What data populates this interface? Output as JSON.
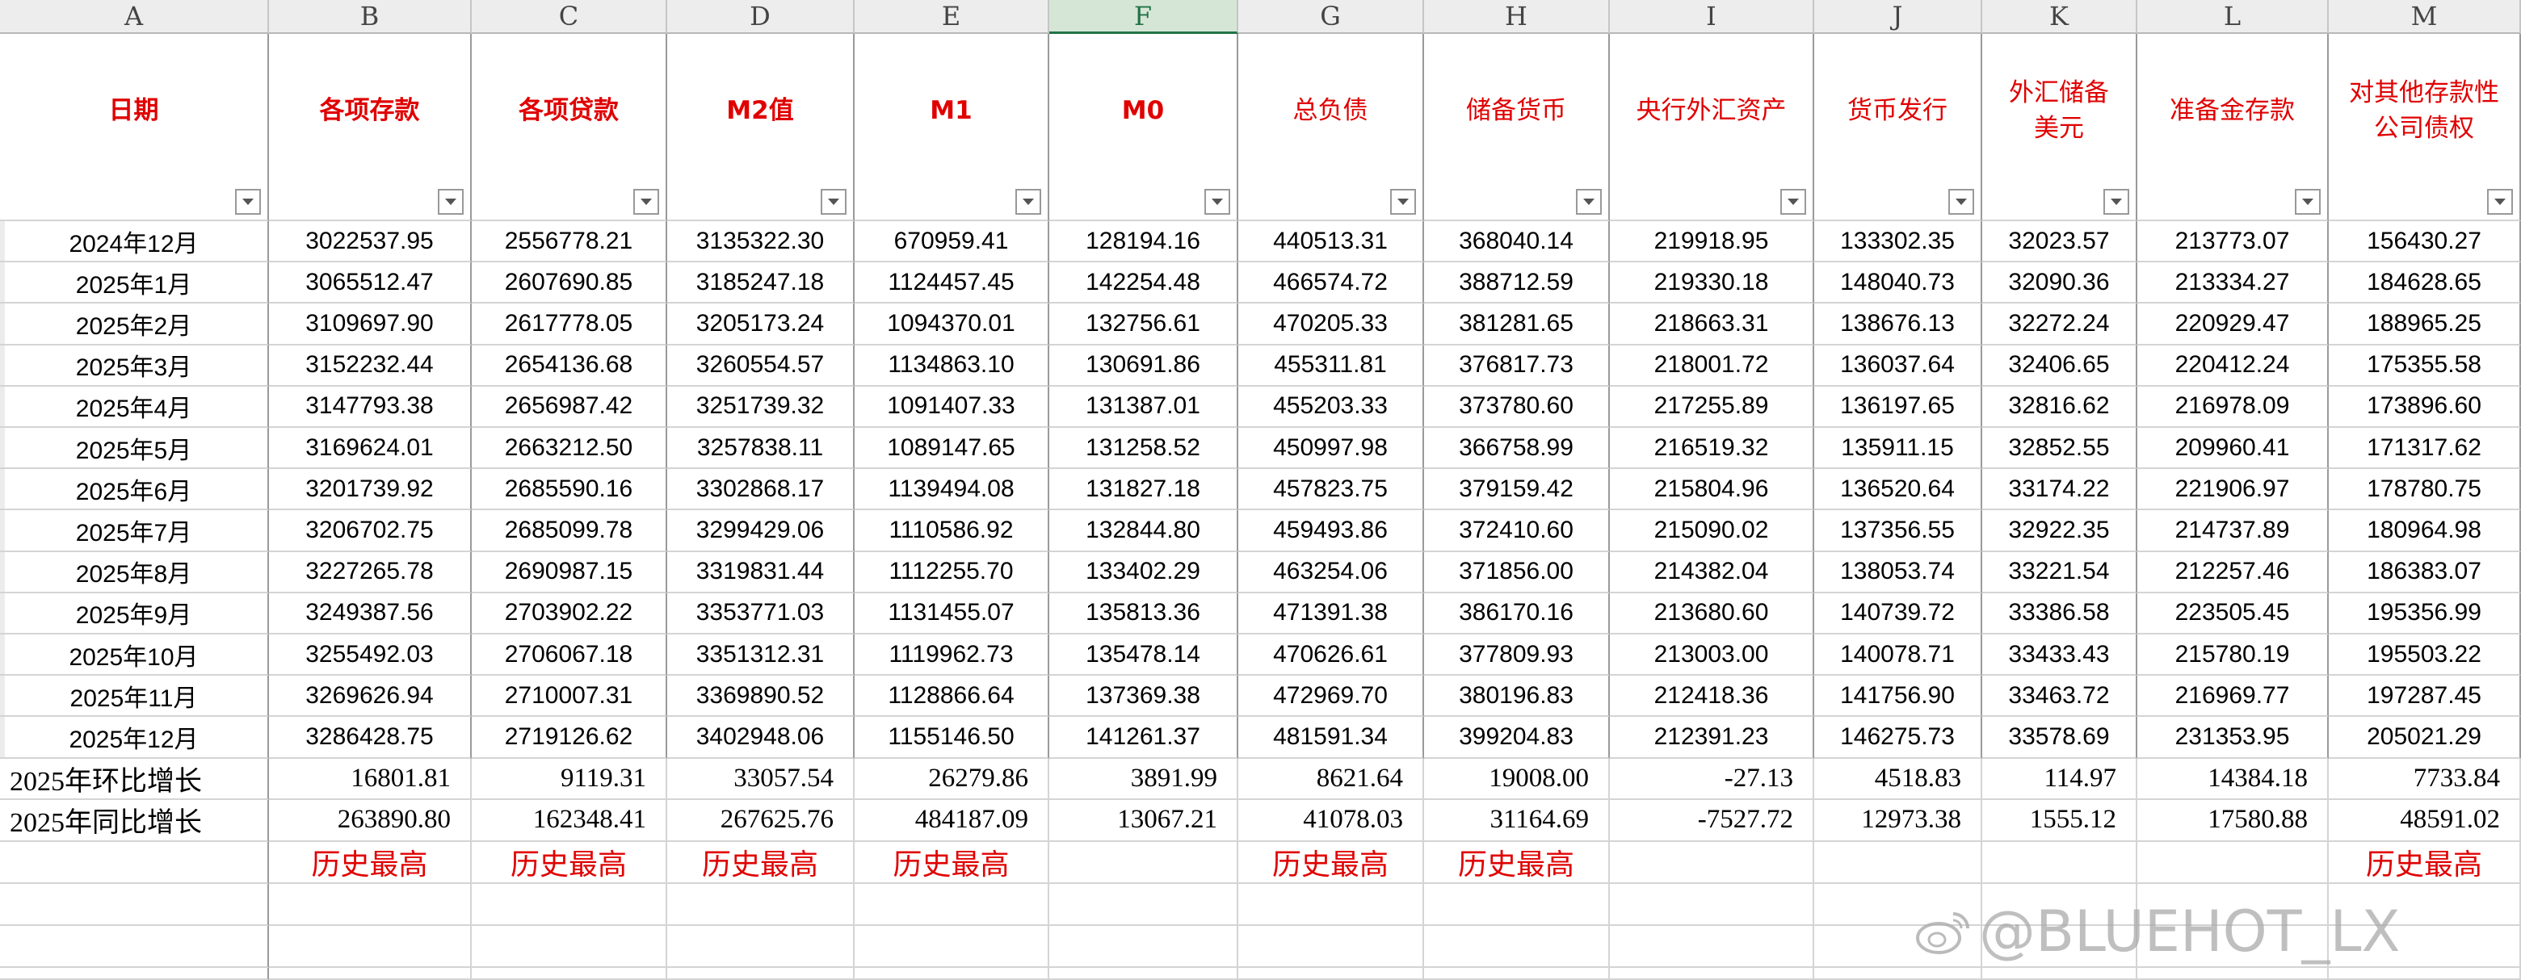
{
  "columns": [
    "A",
    "B",
    "C",
    "D",
    "E",
    "F",
    "G",
    "H",
    "I",
    "J",
    "K",
    "L",
    "M"
  ],
  "selected_column": "F",
  "headers": [
    "日期",
    "各项存款",
    "各项贷款",
    "M2值",
    "M1",
    "M0",
    "总负债",
    "储备货币",
    "央行外汇资产",
    "货币发行",
    "外汇储备美元",
    "准备金存款",
    "对其他存款性公司债权"
  ],
  "header_lines": {
    "10": [
      "外汇储备",
      "美元"
    ],
    "12": [
      "对其他存款性",
      "公司债权"
    ]
  },
  "rows": [
    [
      "2024年12月",
      "3022537.95",
      "2556778.21",
      "3135322.30",
      "670959.41",
      "128194.16",
      "440513.31",
      "368040.14",
      "219918.95",
      "133302.35",
      "32023.57",
      "213773.07",
      "156430.27"
    ],
    [
      "2025年1月",
      "3065512.47",
      "2607690.85",
      "3185247.18",
      "1124457.45",
      "142254.48",
      "466574.72",
      "388712.59",
      "219330.18",
      "148040.73",
      "32090.36",
      "213334.27",
      "184628.65"
    ],
    [
      "2025年2月",
      "3109697.90",
      "2617778.05",
      "3205173.24",
      "1094370.01",
      "132756.61",
      "470205.33",
      "381281.65",
      "218663.31",
      "138676.13",
      "32272.24",
      "220929.47",
      "188965.25"
    ],
    [
      "2025年3月",
      "3152232.44",
      "2654136.68",
      "3260554.57",
      "1134863.10",
      "130691.86",
      "455311.81",
      "376817.73",
      "218001.72",
      "136037.64",
      "32406.65",
      "220412.24",
      "175355.58"
    ],
    [
      "2025年4月",
      "3147793.38",
      "2656987.42",
      "3251739.32",
      "1091407.33",
      "131387.01",
      "455203.33",
      "373780.60",
      "217255.89",
      "136197.65",
      "32816.62",
      "216978.09",
      "173896.60"
    ],
    [
      "2025年5月",
      "3169624.01",
      "2663212.50",
      "3257838.11",
      "1089147.65",
      "131258.52",
      "450997.98",
      "366758.99",
      "216519.32",
      "135911.15",
      "32852.55",
      "209960.41",
      "171317.62"
    ],
    [
      "2025年6月",
      "3201739.92",
      "2685590.16",
      "3302868.17",
      "1139494.08",
      "131827.18",
      "457823.75",
      "379159.42",
      "215804.96",
      "136520.64",
      "33174.22",
      "221906.97",
      "178780.75"
    ],
    [
      "2025年7月",
      "3206702.75",
      "2685099.78",
      "3299429.06",
      "1110586.92",
      "132844.80",
      "459493.86",
      "372410.60",
      "215090.02",
      "137356.55",
      "32922.35",
      "214737.89",
      "180964.98"
    ],
    [
      "2025年8月",
      "3227265.78",
      "2690987.15",
      "3319831.44",
      "1112255.70",
      "133402.29",
      "463254.06",
      "371856.00",
      "214382.04",
      "138053.74",
      "33221.54",
      "212257.46",
      "186383.07"
    ],
    [
      "2025年9月",
      "3249387.56",
      "2703902.22",
      "3353771.03",
      "1131455.07",
      "135813.36",
      "471391.38",
      "386170.16",
      "213680.60",
      "140739.72",
      "33386.58",
      "223505.45",
      "195356.99"
    ],
    [
      "2025年10月",
      "3255492.03",
      "2706067.18",
      "3351312.31",
      "1119962.73",
      "135478.14",
      "470626.61",
      "377809.93",
      "213003.00",
      "140078.71",
      "33433.43",
      "215780.19",
      "195503.22"
    ],
    [
      "2025年11月",
      "3269626.94",
      "2710007.31",
      "3369890.52",
      "1128866.64",
      "137369.38",
      "472969.70",
      "380196.83",
      "212418.36",
      "141756.90",
      "33463.72",
      "216969.77",
      "197287.45"
    ],
    [
      "2025年12月",
      "3286428.75",
      "2719126.62",
      "3402948.06",
      "1155146.50",
      "141261.37",
      "481591.34",
      "399204.83",
      "212391.23",
      "146275.73",
      "33578.69",
      "231353.95",
      "205021.29"
    ]
  ],
  "summary_rows": [
    [
      "2025年环比增长",
      "16801.81",
      "9119.31",
      "33057.54",
      "26279.86",
      "3891.99",
      "8621.64",
      "19008.00",
      "-27.13",
      "4518.83",
      "114.97",
      "14384.18",
      "7733.84"
    ],
    [
      "2025年同比增长",
      "263890.80",
      "162348.41",
      "267625.76",
      "484187.09",
      "13067.21",
      "41078.03",
      "31164.69",
      "-7527.72",
      "12973.38",
      "1555.12",
      "17580.88",
      "48591.02"
    ]
  ],
  "notes": [
    "",
    "历史最高",
    "历史最高",
    "历史最高",
    "历史最高",
    "",
    "历史最高",
    "历史最高",
    "",
    "",
    "",
    "",
    "历史最高"
  ],
  "watermark": "@BLUEHOT_LX",
  "watermark_icon": "weibo-icon",
  "colors": {
    "header_text": "#e00000",
    "note_text": "#e00000",
    "selected_column": "#217346"
  }
}
